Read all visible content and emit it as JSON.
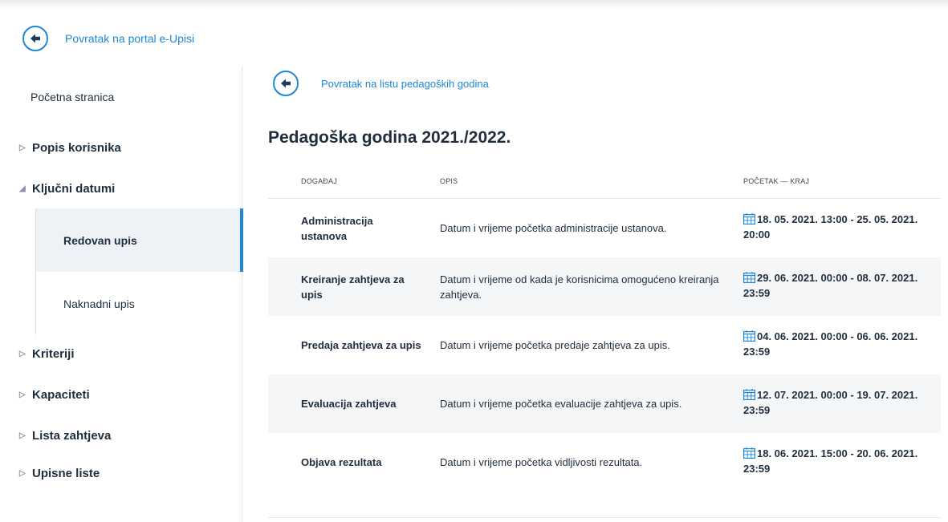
{
  "portal_back": {
    "label": "Povratak na portal e-Upisi"
  },
  "sidebar": {
    "home": "Početna stranica",
    "items": [
      {
        "label": "Popis korisnika",
        "expanded": false
      },
      {
        "label": "Ključni datumi",
        "expanded": true
      },
      {
        "label": "Kriteriji",
        "expanded": false
      },
      {
        "label": "Kapaciteti",
        "expanded": false
      },
      {
        "label": "Lista zahtjeva",
        "expanded": false
      },
      {
        "label": "Upisne liste",
        "expanded": false
      }
    ],
    "subitems": [
      {
        "label": "Redovan upis",
        "active": true
      },
      {
        "label": "Naknadni upis",
        "active": false
      }
    ]
  },
  "main": {
    "back_label": "Povratak na listu pedagoških godina",
    "title": "Pedagoška godina 2021./2022.",
    "columns": [
      "DOGAĐAJ",
      "OPIS",
      "POČETAK — KRAJ"
    ],
    "rows": [
      {
        "event": "Administracija ustanova",
        "description": "Datum i vrijeme početka administracije ustanova.",
        "range": "18. 05. 2021. 13:00 - 25. 05. 2021. 20:00"
      },
      {
        "event": "Kreiranje zahtjeva za upis",
        "description": "Datum i vrijeme od kada je korisnicima omogućeno kreiranja zahtjeva.",
        "range": "29. 06. 2021. 00:00 - 08. 07. 2021. 23:59"
      },
      {
        "event": "Predaja zahtjeva za upis",
        "description": "Datum i vrijeme početka predaje zahtjeva za upis.",
        "range": "04. 06. 2021. 00:00 - 06. 06. 2021. 23:59"
      },
      {
        "event": "Evaluacija zahtjeva",
        "description": "Datum i vrijeme početka evaluacije zahtjeva za upis.",
        "range": "12. 07. 2021. 00:00 - 19. 07. 2021. 23:59"
      },
      {
        "event": "Objava rezultata",
        "description": "Datum i vrijeme početka vidljivosti rezultata.",
        "range": "18. 06. 2021. 15:00 - 20. 06. 2021. 23:59"
      }
    ]
  },
  "colors": {
    "accent": "#1e88d6",
    "active_bg": "#eef2f7",
    "row_alt": "#f4f6f8"
  },
  "icons": {
    "back": "arrow-left-icon",
    "calendar": "calendar-icon",
    "collapsed": "triangle-right-icon",
    "expanded": "triangle-down-icon"
  }
}
